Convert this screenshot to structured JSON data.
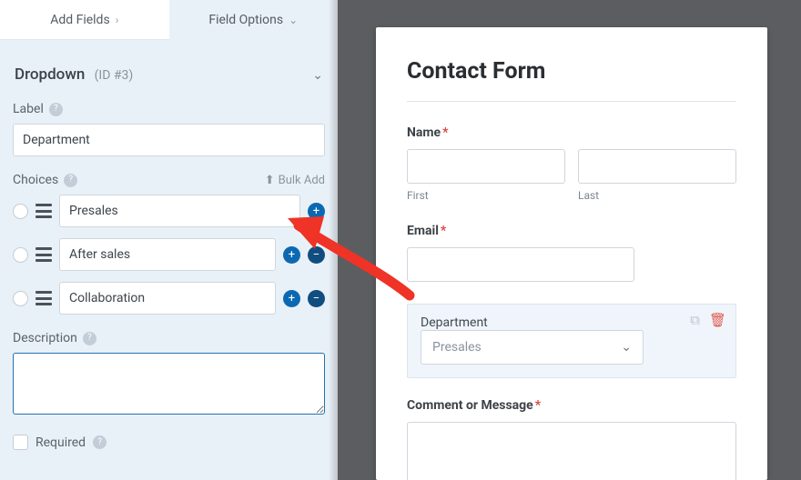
{
  "tabs": {
    "add_fields": "Add Fields",
    "field_options": "Field Options"
  },
  "section": {
    "title": "Dropdown",
    "id_note": "(ID #3)"
  },
  "label_field": {
    "label": "Label",
    "value": "Department"
  },
  "choices_field": {
    "label": "Choices",
    "bulk_add": "Bulk Add",
    "items": [
      "Presales",
      "After sales",
      "Collaboration"
    ]
  },
  "description_field": {
    "label": "Description",
    "value": ""
  },
  "required_field": {
    "label": "Required"
  },
  "preview": {
    "title": "Contact Form",
    "name": {
      "label": "Name",
      "sub_first": "First",
      "sub_last": "Last"
    },
    "email": {
      "label": "Email"
    },
    "department": {
      "label": "Department",
      "selected": "Presales"
    },
    "comment": {
      "label": "Comment or Message"
    }
  },
  "icons": {
    "chev_right": "›",
    "chev_down": "⌄",
    "help": "?",
    "upload": "⬆",
    "plus": "+",
    "minus": "−",
    "copy": "⧉",
    "trash": "🗑"
  }
}
